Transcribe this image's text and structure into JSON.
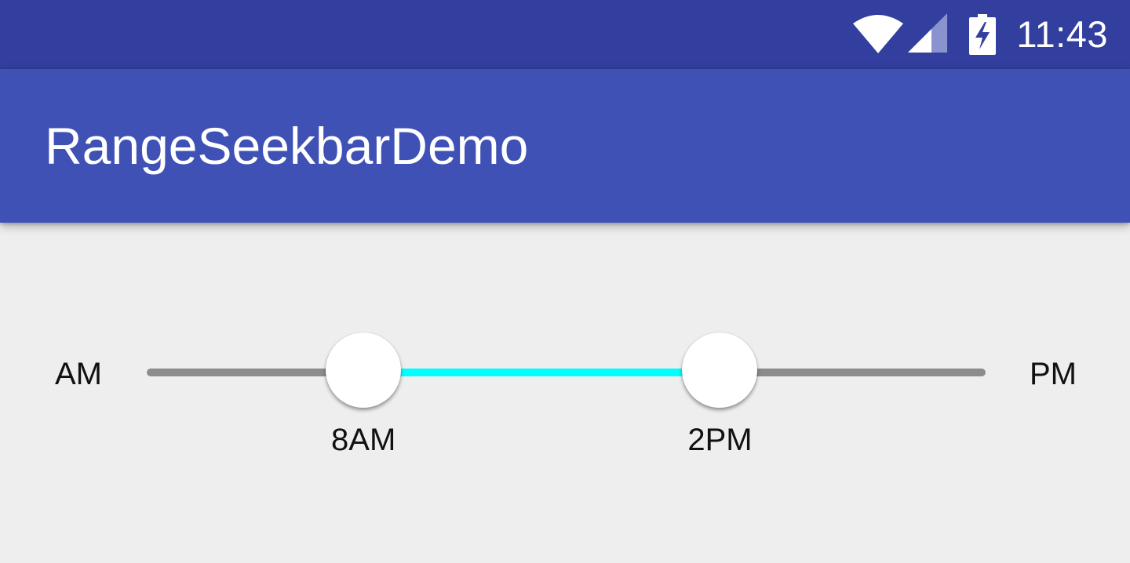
{
  "status_bar": {
    "time": "11:43",
    "icons": [
      "wifi-icon",
      "cellular-signal-icon",
      "battery-charging-icon"
    ],
    "background": "#333F9E"
  },
  "app_bar": {
    "title": "RangeSeekbarDemo",
    "background": "#3F51B5"
  },
  "range_seekbar": {
    "min_label": "AM",
    "max_label": "PM",
    "range_min_hour": 0,
    "range_max_hour": 24,
    "start": {
      "label": "8AM",
      "hour": 6.2
    },
    "end": {
      "label": "2PM",
      "hour": 16.4
    },
    "track_color": "#8C8C8C",
    "selected_color": "#00FFFF",
    "thumb_color": "#FFFFFF"
  },
  "colors": {
    "background": "#EEEEEE",
    "text": "#111111"
  }
}
